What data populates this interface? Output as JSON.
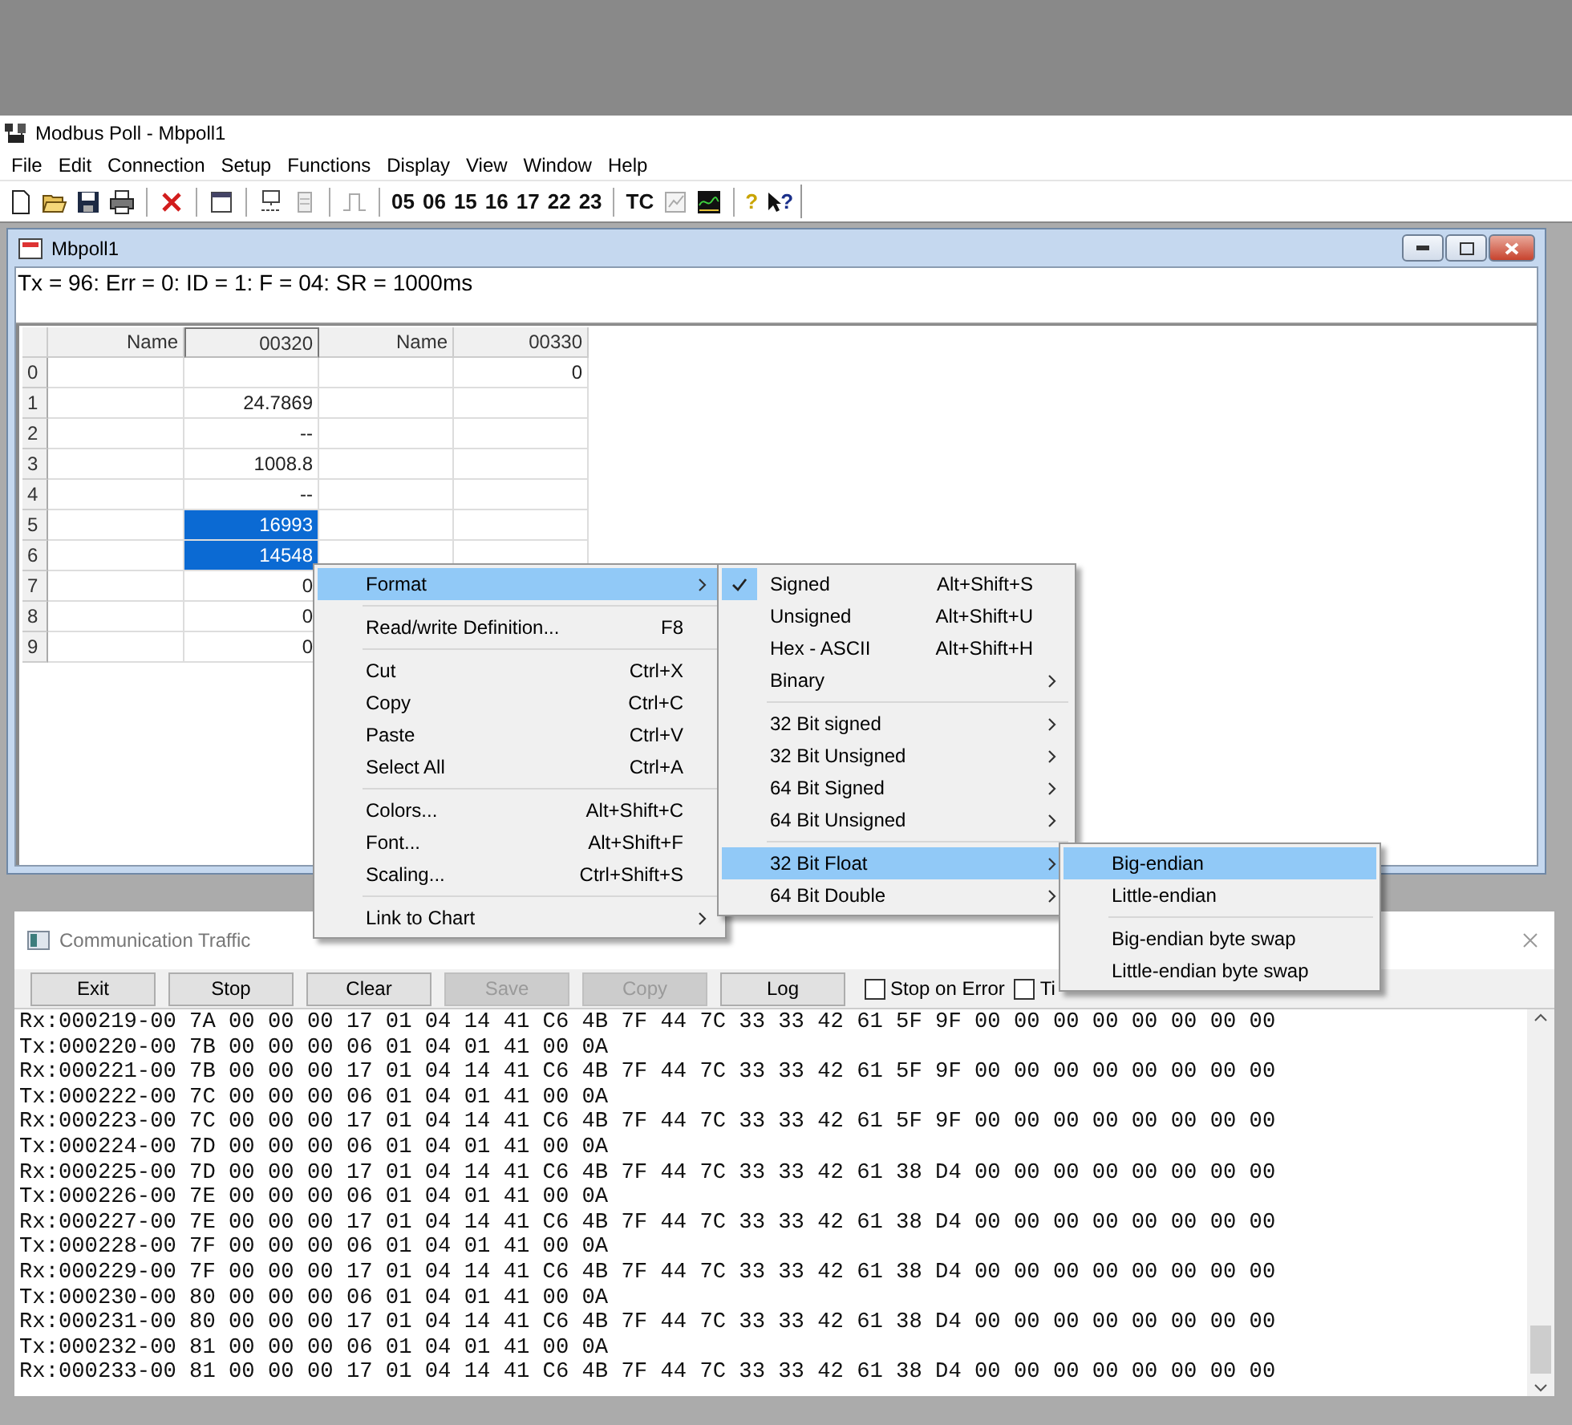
{
  "app_title": "Modbus Poll - Mbpoll1",
  "menu": [
    "File",
    "Edit",
    "Connection",
    "Setup",
    "Functions",
    "Display",
    "View",
    "Window",
    "Help"
  ],
  "toolbar": {
    "function_codes": [
      "05",
      "06",
      "15",
      "16",
      "17",
      "22",
      "23"
    ],
    "tc_label": "TC",
    "help_labels": [
      "?",
      "?"
    ]
  },
  "child_window": {
    "title": "Mbpoll1",
    "status": "Tx = 96: Err = 0: ID = 1: F = 04: SR = 1000ms",
    "columns": [
      "Name",
      "00320",
      "Name",
      "00330"
    ],
    "rows": [
      {
        "header": "0",
        "col_4": "0",
        "selected": false
      },
      {
        "header": "1",
        "col_2": "24.7869",
        "selected": false
      },
      {
        "header": "2",
        "col_2": "--",
        "selected": false
      },
      {
        "header": "3",
        "col_2": "1008.8",
        "selected": false
      },
      {
        "header": "4",
        "col_2": "--",
        "selected": false
      },
      {
        "header": "5",
        "col_2": "16993",
        "selected": true
      },
      {
        "header": "6",
        "col_2": "14548",
        "selected": true
      },
      {
        "header": "7",
        "col_2": "0",
        "selected": false
      },
      {
        "header": "8",
        "col_2": "0",
        "selected": false
      },
      {
        "header": "9",
        "col_2": "0",
        "selected": false
      }
    ]
  },
  "context_menu": [
    {
      "kind": "item",
      "label": "Format",
      "submenu": true,
      "highlighted": true
    },
    {
      "kind": "separator"
    },
    {
      "kind": "item",
      "label": "Read/write Definition...",
      "shortcut": "F8",
      "highlighted": false
    },
    {
      "kind": "separator"
    },
    {
      "kind": "item",
      "label": "Cut",
      "shortcut": "Ctrl+X",
      "highlighted": false
    },
    {
      "kind": "item",
      "label": "Copy",
      "shortcut": "Ctrl+C",
      "highlighted": false
    },
    {
      "kind": "item",
      "label": "Paste",
      "shortcut": "Ctrl+V",
      "highlighted": false
    },
    {
      "kind": "item",
      "label": "Select All",
      "shortcut": "Ctrl+A",
      "highlighted": false
    },
    {
      "kind": "separator"
    },
    {
      "kind": "item",
      "label": "Colors...",
      "shortcut": "Alt+Shift+C",
      "highlighted": false
    },
    {
      "kind": "item",
      "label": "Font...",
      "shortcut": "Alt+Shift+F",
      "highlighted": false
    },
    {
      "kind": "item",
      "label": "Scaling...",
      "shortcut": "Ctrl+Shift+S",
      "highlighted": false
    },
    {
      "kind": "separator"
    },
    {
      "kind": "item",
      "label": "Link to Chart",
      "submenu": true,
      "highlighted": false
    }
  ],
  "format_menu": [
    {
      "kind": "item",
      "label": "Signed",
      "shortcut": "Alt+Shift+S",
      "checked": true,
      "highlighted": false
    },
    {
      "kind": "item",
      "label": "Unsigned",
      "shortcut": "Alt+Shift+U",
      "checked": false,
      "highlighted": false
    },
    {
      "kind": "item",
      "label": "Hex - ASCII",
      "shortcut": "Alt+Shift+H",
      "checked": false,
      "highlighted": false
    },
    {
      "kind": "item",
      "label": "Binary",
      "submenu": true,
      "checked": false,
      "highlighted": false
    },
    {
      "kind": "separator"
    },
    {
      "kind": "item",
      "label": "32 Bit signed",
      "submenu": true,
      "checked": false,
      "highlighted": false
    },
    {
      "kind": "item",
      "label": "32 Bit Unsigned",
      "submenu": true,
      "checked": false,
      "highlighted": false
    },
    {
      "kind": "item",
      "label": "64 Bit Signed",
      "submenu": true,
      "checked": false,
      "highlighted": false
    },
    {
      "kind": "item",
      "label": "64 Bit Unsigned",
      "submenu": true,
      "checked": false,
      "highlighted": false
    },
    {
      "kind": "separator"
    },
    {
      "kind": "item",
      "label": "32 Bit Float",
      "submenu": true,
      "checked": false,
      "highlighted": true
    },
    {
      "kind": "item",
      "label": "64 Bit Double",
      "submenu": true,
      "checked": false,
      "highlighted": false
    }
  ],
  "endian_menu": [
    {
      "kind": "item",
      "label": "Big-endian",
      "highlighted": true
    },
    {
      "kind": "item",
      "label": "Little-endian",
      "highlighted": false
    },
    {
      "kind": "separator"
    },
    {
      "kind": "item",
      "label": "Big-endian byte swap",
      "highlighted": false
    },
    {
      "kind": "item",
      "label": "Little-endian byte swap",
      "highlighted": false
    }
  ],
  "traffic_window": {
    "title": "Communication Traffic",
    "buttons": [
      {
        "label": "Exit",
        "disabled": false
      },
      {
        "label": "Stop",
        "disabled": false
      },
      {
        "label": "Clear",
        "disabled": false
      },
      {
        "label": "Save",
        "disabled": true
      },
      {
        "label": "Copy",
        "disabled": true
      },
      {
        "label": "Log",
        "disabled": false
      }
    ],
    "checkboxes": [
      {
        "label": "Stop on Error",
        "checked": false
      },
      {
        "label": "Ti",
        "checked": false
      }
    ],
    "log": [
      "Rx:000219-00 7A 00 00 00 17 01 04 14 41 C6 4B 7F 44 7C 33 33 42 61 5F 9F 00 00 00 00 00 00 00 00",
      "Tx:000220-00 7B 00 00 00 06 01 04 01 41 00 0A",
      "Rx:000221-00 7B 00 00 00 17 01 04 14 41 C6 4B 7F 44 7C 33 33 42 61 5F 9F 00 00 00 00 00 00 00 00",
      "Tx:000222-00 7C 00 00 00 06 01 04 01 41 00 0A",
      "Rx:000223-00 7C 00 00 00 17 01 04 14 41 C6 4B 7F 44 7C 33 33 42 61 5F 9F 00 00 00 00 00 00 00 00",
      "Tx:000224-00 7D 00 00 00 06 01 04 01 41 00 0A",
      "Rx:000225-00 7D 00 00 00 17 01 04 14 41 C6 4B 7F 44 7C 33 33 42 61 38 D4 00 00 00 00 00 00 00 00",
      "Tx:000226-00 7E 00 00 00 06 01 04 01 41 00 0A",
      "Rx:000227-00 7E 00 00 00 17 01 04 14 41 C6 4B 7F 44 7C 33 33 42 61 38 D4 00 00 00 00 00 00 00 00",
      "Tx:000228-00 7F 00 00 00 06 01 04 01 41 00 0A",
      "Rx:000229-00 7F 00 00 00 17 01 04 14 41 C6 4B 7F 44 7C 33 33 42 61 38 D4 00 00 00 00 00 00 00 00",
      "Tx:000230-00 80 00 00 00 06 01 04 01 41 00 0A",
      "Rx:000231-00 80 00 00 00 17 01 04 14 41 C6 4B 7F 44 7C 33 33 42 61 38 D4 00 00 00 00 00 00 00 00",
      "Tx:000232-00 81 00 00 00 06 01 04 01 41 00 0A",
      "Rx:000233-00 81 00 00 00 17 01 04 14 41 C6 4B 7F 44 7C 33 33 42 61 38 D4 00 00 00 00 00 00 00 00"
    ]
  }
}
